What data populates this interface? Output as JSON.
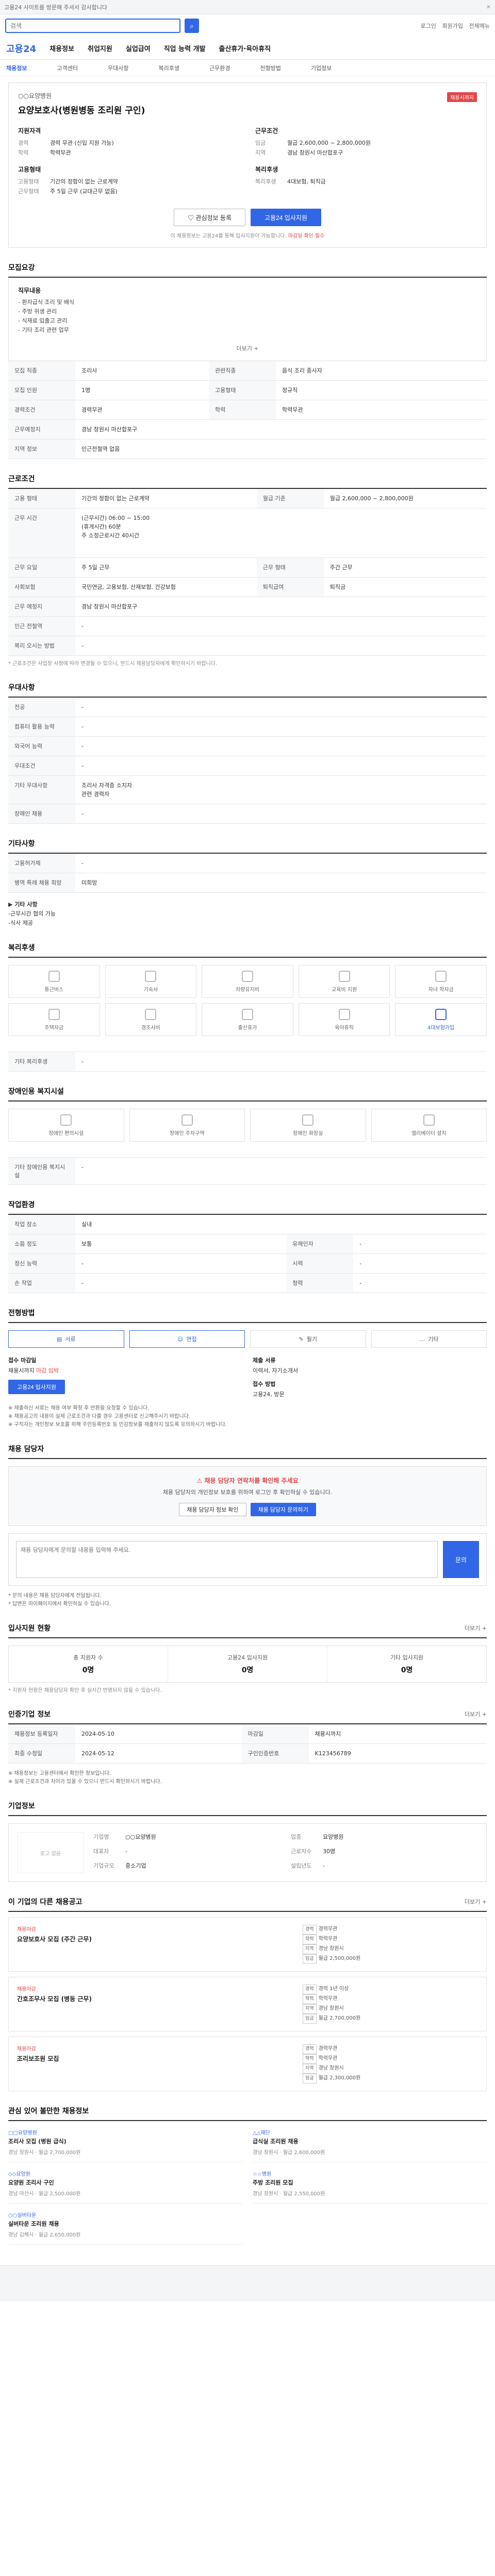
{
  "topbar": {
    "text": "고용24 사이트를 방문해 주셔서 감사합니다",
    "close": "✕"
  },
  "search": {
    "placeholder": "검색",
    "util": [
      "로그인",
      "회원가입",
      "전체메뉴"
    ]
  },
  "gnb": {
    "logo": "고용24",
    "items": [
      "채용정보",
      "취업지원",
      "실업급여",
      "직업 능력 개발",
      "출산휴가·육아휴직"
    ]
  },
  "subnav": {
    "items": [
      "채용정보",
      "고객센터",
      "우대사항",
      "복리후생",
      "근무환경",
      "전형방법",
      "기업정보"
    ],
    "active": 0
  },
  "job": {
    "title": "요양보호사(병원병동 조리원 구인)",
    "company": "○○요양병원",
    "status": "채용시까지",
    "summary_left_title": "지원자격",
    "summary_left": [
      {
        "k": "경력",
        "v": "경력 무관 (신입 지원 가능)"
      },
      {
        "k": "학력",
        "v": "학력무관"
      }
    ],
    "summary_right_title": "근무조건",
    "summary_right": [
      {
        "k": "임금",
        "v": "월급 2,600,000 ~ 2,800,000원"
      },
      {
        "k": "지역",
        "v": "경남 창원시 마산합포구"
      }
    ],
    "summary_left2_title": "고용형태",
    "summary_left2": [
      {
        "k": "고용형태",
        "v": "기간의 정함이 없는 근로계약"
      },
      {
        "k": "근무형태",
        "v": "주 5일 근무 (교대근무 없음)"
      }
    ],
    "summary_right2_title": "복리후생",
    "summary_right2": [
      {
        "k": "복리후생",
        "v": "4대보험, 퇴직금"
      }
    ],
    "btn_interest": "관심정보 등록",
    "btn_apply": "고용24 입사지원",
    "notice": "이 채용정보는 고용24를 통해 입사지원이 가능합니다.",
    "notice_red": "마감일 확인 필수"
  },
  "recruit": {
    "title": "모집요강",
    "duty_title": "직무내용",
    "duty": [
      "- 환자급식 조리 및 배식",
      "- 주방 위생 관리",
      "- 식재료 입출고 관리",
      "- 기타 조리 관련 업무"
    ],
    "more": "더보기 +",
    "rows": [
      {
        "k": "모집 직종",
        "v": "조리사",
        "k2": "관련직종",
        "v2": "음식 조리 종사자"
      },
      {
        "k": "모집 인원",
        "v": "1명",
        "k2": "고용형태",
        "v2": "정규직"
      },
      {
        "k": "경력조건",
        "v": "경력무관",
        "k2": "학력",
        "v2": "학력무관"
      },
      {
        "k": "근무예정지",
        "v": "경남 창원시 마산합포구",
        "k2": "",
        "v2": ""
      },
      {
        "k": "지역 정보",
        "v": "인근전철역 없음",
        "k2": "",
        "v2": ""
      }
    ]
  },
  "conditions": {
    "title": "근로조건",
    "rows": [
      {
        "k": "고용 형태",
        "v": "기간의 정함이 없는 근로계약",
        "k2": "월급 기준",
        "v2": "월급 2,600,000 ~ 2,800,000원"
      },
      {
        "k": "근무 시간",
        "v": "(근무시간) 06:00 ~ 15:00\n(휴게시간) 60분\n주 소정근로시간 40시간",
        "k2": "",
        "v2": ""
      },
      {
        "k": "근무 요일",
        "v": "주 5일 근무",
        "k2": "근무 형태",
        "v2": "주간 근무"
      },
      {
        "k": "사회보험",
        "v": "국민연금, 고용보험, 산재보험, 건강보험",
        "k2": "퇴직급여",
        "v2": "퇴직금"
      },
      {
        "k": "근무 예정지",
        "v": "경남 창원시 마산합포구",
        "k2": "",
        "v2": ""
      },
      {
        "k": "인근 전철역",
        "v": "-",
        "k2": "",
        "v2": ""
      },
      {
        "k": "복리 오시는 방법",
        "v": "-",
        "k2": "",
        "v2": ""
      }
    ],
    "note": "* 근로조건은 사업장 사정에 따라 변경될 수 있으니, 반드시 채용담당자에게 확인하시기 바랍니다."
  },
  "pref": {
    "title": "우대사항",
    "rows": [
      {
        "k": "전공",
        "v": "-"
      },
      {
        "k": "컴퓨터 활용 능력",
        "v": "-"
      },
      {
        "k": "외국어 능력",
        "v": "-"
      },
      {
        "k": "우대조건",
        "v": "-"
      },
      {
        "k": "기타 우대사항",
        "v": "조리사 자격증 소지자\n관련 경력자"
      },
      {
        "k": "장애인 채용",
        "v": "-"
      }
    ]
  },
  "etc": {
    "title": "기타사항",
    "rows": [
      {
        "k": "고용허가제",
        "v": "-"
      },
      {
        "k": "병역 특례 채용 희망",
        "v": "미희망"
      }
    ],
    "memo_title": "▶ 기타 사항",
    "memo": [
      "-근무시간 협의 가능",
      "-식사 제공"
    ]
  },
  "welfare": {
    "title": "복리후생",
    "items": [
      "통근버스",
      "기숙사",
      "차량유지비",
      "교육비 지원",
      "자녀 학자금",
      "주택자금",
      "경조사비",
      "출산휴가",
      "육아휴직",
      "4대보험가입"
    ],
    "sub_title": "기타 복리후생",
    "sub_value": "-"
  },
  "disability": {
    "title": "장애인용 복지시설",
    "items": [
      "장애인 편의시설",
      "장애인 주차구역",
      "장애인 화장실",
      "엘리베이터 설치"
    ],
    "sub_title": "기타 장애인용 복지시설",
    "sub_value": "-"
  },
  "env": {
    "title": "작업환경",
    "rows": [
      {
        "k": "작업 장소",
        "v": "실내",
        "k2": "",
        "v2": ""
      },
      {
        "k": "소음 정도",
        "v": "보통",
        "k2": "유해인자",
        "v2": "-"
      },
      {
        "k": "정신 능력",
        "v": "-",
        "k2": "시력",
        "v2": "-"
      },
      {
        "k": "손 작업",
        "v": "-",
        "k2": "청력",
        "v2": "-"
      }
    ]
  },
  "method": {
    "title": "전형방법",
    "items": [
      "서류",
      "면접",
      "필기",
      "기타"
    ],
    "active": [
      true,
      true,
      false,
      false
    ],
    "apply_method_label": "접수 마감일",
    "apply_method_value": "채용시까지",
    "apply_method_red": "마감 임박",
    "doc_label": "제출 서류",
    "doc_value": "이력서, 자기소개서",
    "btn": "고용24 입사지원",
    "channel_label": "접수 방법",
    "channel_value": "고용24, 방문",
    "notes": [
      "※ 제출하신 서류는 채용 여부 확정 후 반환을 요청할 수 있습니다.",
      "※ 채용공고의 내용이 실제 근로조건과 다를 경우 고용센터로 신고해주시기 바랍니다.",
      "※ 구직자는 개인정보 보호를 위해 주민등록번호 등 민감정보를 제출하지 않도록 유의하시기 바랍니다."
    ]
  },
  "contact": {
    "title": "채용 담당자",
    "warn_title": "채용 담당자 연락처를 확인해 주세요",
    "warn_text": "채용 담당자의 개인정보 보호를 위하여 로그인 후 확인하실 수 있습니다.",
    "btn1": "채용 담당자 정보 확인",
    "btn2": "채용 담당자 문의하기",
    "inquiry_placeholder": "채용 담당자에게 문의할 내용을 입력해 주세요.",
    "inquiry_btn": "문의",
    "notes": [
      "* 문의 내용은 채용 담당자에게 전달됩니다.",
      "* 답변은 마이페이지에서 확인하실 수 있습니다."
    ]
  },
  "status": {
    "title": "입사지원 현황",
    "more": "더보기 +",
    "stats": [
      {
        "label": "총 지원자 수",
        "value": "0명"
      },
      {
        "label": "고용24 입사지원",
        "value": "0명"
      },
      {
        "label": "기타 입사지원",
        "value": "0명"
      }
    ],
    "note": "* 지원자 현황은 채용담당자 확인 후 실시간 반영되지 않을 수 있습니다."
  },
  "info": {
    "title": "인증기업 정보",
    "more": "더보기 +",
    "rows": [
      {
        "k": "채용정보 등록일자",
        "v": "2024-05-10",
        "k2": "마감일",
        "v2": "채용시까지"
      },
      {
        "k": "최종 수정일",
        "v": "2024-05-12",
        "k2": "구인인증번호",
        "v2": "K123456789"
      }
    ],
    "notes": [
      "※ 채용정보는 고용센터에서 확인한 정보입니다.",
      "※ 실제 근로조건과 차이가 있을 수 있으니 반드시 확인하시기 바랍니다."
    ]
  },
  "company": {
    "title": "기업정보",
    "logo": "로고 없음",
    "fields": [
      {
        "k": "기업명",
        "v": "○○요양병원"
      },
      {
        "k": "업종",
        "v": "요양병원"
      },
      {
        "k": "대표자",
        "v": "-"
      },
      {
        "k": "근로자수",
        "v": "30명"
      },
      {
        "k": "기업규모",
        "v": "중소기업"
      },
      {
        "k": "설립년도",
        "v": "-"
      }
    ]
  },
  "related": {
    "title": "이 기업의 다른 채용공고",
    "more": "더보기 +",
    "items": [
      {
        "co": "채용마감",
        "title": "요양보호사 모집 (주간 근무)",
        "meta": [
          "경력무관",
          "학력무관",
          "경남 창원시",
          "월급 2,500,000원"
        ]
      },
      {
        "co": "채용마감",
        "title": "간호조무사 모집 (병동 근무)",
        "meta": [
          "경력 1년 이상",
          "학력무관",
          "경남 창원시",
          "월급 2,700,000원"
        ]
      },
      {
        "co": "채용마감",
        "title": "조리보조원 모집",
        "meta": [
          "경력무관",
          "학력무관",
          "경남 창원시",
          "월급 2,300,000원"
        ]
      }
    ]
  },
  "recommend": {
    "title": "관심 있어 볼만한 채용정보",
    "items": [
      {
        "co": "□□요양병원",
        "title": "조리사 모집 (병원 급식)",
        "meta": "경남 창원시 · 월급 2,700,000원"
      },
      {
        "co": "△△재단",
        "title": "급식실 조리원 채용",
        "meta": "경남 창원시 · 월급 2,600,000원"
      },
      {
        "co": "◇◇요양원",
        "title": "요양원 조리사 구인",
        "meta": "경남 마산시 · 월급 2,500,000원"
      },
      {
        "co": "☆☆병원",
        "title": "주방 조리원 모집",
        "meta": "경남 창원시 · 월급 2,550,000원"
      },
      {
        "co": "○○실버타운",
        "title": "실버타운 조리원 채용",
        "meta": "경남 김해시 · 월급 2,650,000원"
      }
    ]
  }
}
